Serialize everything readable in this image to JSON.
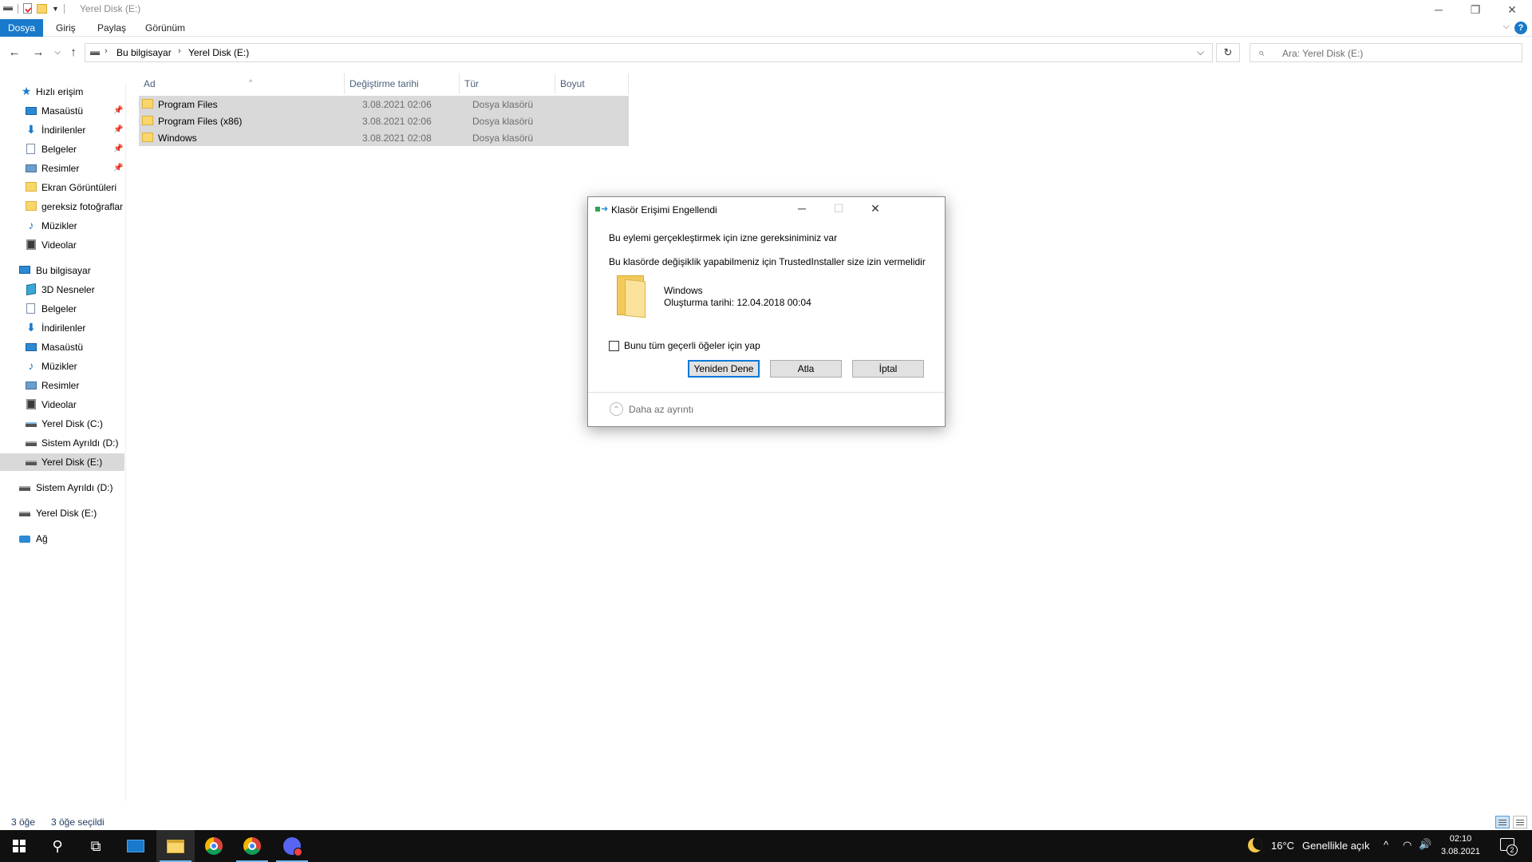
{
  "window": {
    "title": "Yerel Disk (E:)",
    "minimize": "─",
    "restore": "❐",
    "close": "✕"
  },
  "ribbon": {
    "tabs": [
      "Dosya",
      "Giriş",
      "Paylaş",
      "Görünüm"
    ],
    "help": "?",
    "collapse": "⌵"
  },
  "nav": {
    "back": "←",
    "forward": "→",
    "recent": "⌵",
    "up": "↑",
    "breadcrumb": [
      "Bu bilgisayar",
      "Yerel Disk (E:)"
    ],
    "breadcrumb_sep": "›",
    "address_dropdown": "⌵",
    "refresh": "↻",
    "search_placeholder": "Ara: Yerel Disk (E:)",
    "search_icon": "⌕"
  },
  "sidebar": {
    "pin_glyph": "📌",
    "items": [
      {
        "label": "Hızlı erişim",
        "icon": "star-icon",
        "glyph": "★"
      },
      {
        "label": "Masaüstü",
        "icon": "desktop-icon",
        "pinned": true
      },
      {
        "label": "İndirilenler",
        "icon": "download-icon",
        "glyph": "⬇",
        "pinned": true
      },
      {
        "label": "Belgeler",
        "icon": "document-icon",
        "pinned": true
      },
      {
        "label": "Resimler",
        "icon": "pictures-icon",
        "pinned": true
      },
      {
        "label": "Ekran Görüntüleri",
        "icon": "folder-icon"
      },
      {
        "label": "gereksiz fotoğraflar",
        "icon": "folder-icon"
      },
      {
        "label": "Müzikler",
        "icon": "music-icon",
        "glyph": "♪"
      },
      {
        "label": "Videolar",
        "icon": "video-icon"
      },
      {
        "label": "Bu bilgisayar",
        "icon": "computer-icon"
      },
      {
        "label": "3D Nesneler",
        "icon": "3d-objects-icon"
      },
      {
        "label": "Belgeler",
        "icon": "document-icon"
      },
      {
        "label": "İndirilenler",
        "icon": "download-icon",
        "glyph": "⬇"
      },
      {
        "label": "Masaüstü",
        "icon": "desktop-icon"
      },
      {
        "label": "Müzikler",
        "icon": "music-icon",
        "glyph": "♪"
      },
      {
        "label": "Resimler",
        "icon": "pictures-icon"
      },
      {
        "label": "Videolar",
        "icon": "video-icon"
      },
      {
        "label": "Yerel Disk (C:)",
        "icon": "system-drive-icon"
      },
      {
        "label": "Sistem Ayrıldı (D:)",
        "icon": "drive-icon"
      },
      {
        "label": "Yerel Disk (E:)",
        "icon": "drive-icon",
        "selected": true
      },
      {
        "label": "Sistem Ayrıldı (D:)",
        "icon": "drive-icon"
      },
      {
        "label": "Yerel Disk (E:)",
        "icon": "drive-icon"
      },
      {
        "label": "Ağ",
        "icon": "network-icon"
      }
    ]
  },
  "list": {
    "columns": [
      "Ad",
      "Değiştirme tarihi",
      "Tür",
      "Boyut"
    ],
    "sort_arrow": "^",
    "rows": [
      {
        "name": "Program Files",
        "date": "3.08.2021 02:06",
        "type": "Dosya klasörü"
      },
      {
        "name": "Program Files (x86)",
        "date": "3.08.2021 02:06",
        "type": "Dosya klasörü"
      },
      {
        "name": "Windows",
        "date": "3.08.2021 02:08",
        "type": "Dosya klasörü"
      }
    ]
  },
  "status": {
    "count": "3 öğe",
    "selected": "3 öğe seçildi"
  },
  "dialog": {
    "title": "Klasör Erişimi Engellendi",
    "minimize": "─",
    "maximize": "☐",
    "close": "✕",
    "message1": "Bu eylemi gerçekleştirmek için izne gereksiniminiz var",
    "message2": "Bu klasörde değişiklik yapabilmeniz için TrustedInstaller size izin vermelidir",
    "folder_name": "Windows",
    "folder_created": "Oluşturma tarihi: 12.04.2018 00:04",
    "checkbox_label": "Bunu tüm geçerli öğeler için yap",
    "retry": "Yeniden Dene",
    "skip": "Atla",
    "cancel": "İptal",
    "less_details": "Daha az ayrıntı",
    "less_icon": "⌃"
  },
  "taskbar": {
    "search_glyph": "⚲",
    "taskview_glyph": "⧉",
    "temperature": "16°C",
    "weather": "Genellikle açık",
    "tray_chevron": "^",
    "network_glyph": "◠",
    "volume_glyph": "🔊",
    "time": "02:10",
    "date": "3.08.2021",
    "notifications": "2"
  }
}
